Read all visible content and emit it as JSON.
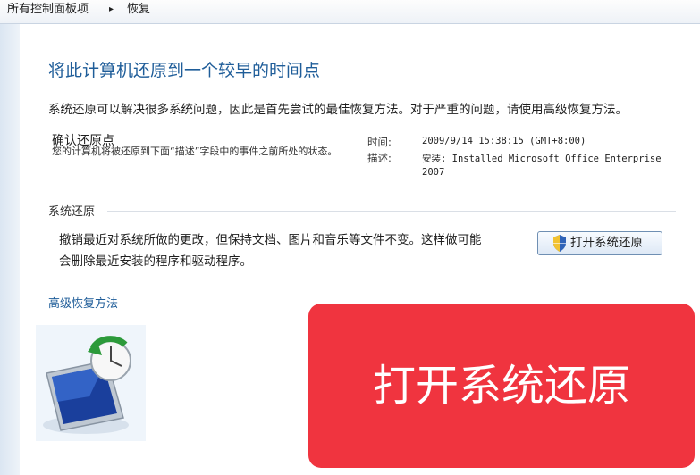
{
  "breadcrumb": {
    "root": "所有控制面板项",
    "separator": "▸",
    "current": "恢复"
  },
  "page": {
    "title": "将此计算机还原到一个较早的时间点",
    "intro": "系统还原可以解决很多系统问题，因此是首先尝试的最佳恢复方法。对于严重的问题，请使用高级恢复方法。"
  },
  "confirm_point": {
    "heading": "确认还原点",
    "description": "您的计算机将被还原到下面“描述”字段中的事件之前所处的状态。",
    "time_label": "时间:",
    "time_value": "2009/9/14 15:38:15 (GMT+8:00)",
    "desc_label": "描述:",
    "desc_value_line1": "安装: Installed Microsoft Office Enterprise",
    "desc_value_line2": "2007"
  },
  "system_restore": {
    "heading": "系统还原",
    "text_line1": "撤销最近对系统所做的更改，但保持文档、图片和音乐等文件不变。这样做可能",
    "text_line2": "会删除最近安装的程序和驱动程序。",
    "button_label": "打开系统还原"
  },
  "advanced_link": "高级恢复方法",
  "callout": {
    "text": "打开系统还原",
    "color": "#f0343f"
  },
  "colors": {
    "title": "#1f5d99",
    "link": "#1f5d99"
  },
  "icons": {
    "shield": "uac-shield-icon",
    "restore": "system-restore-icon"
  }
}
